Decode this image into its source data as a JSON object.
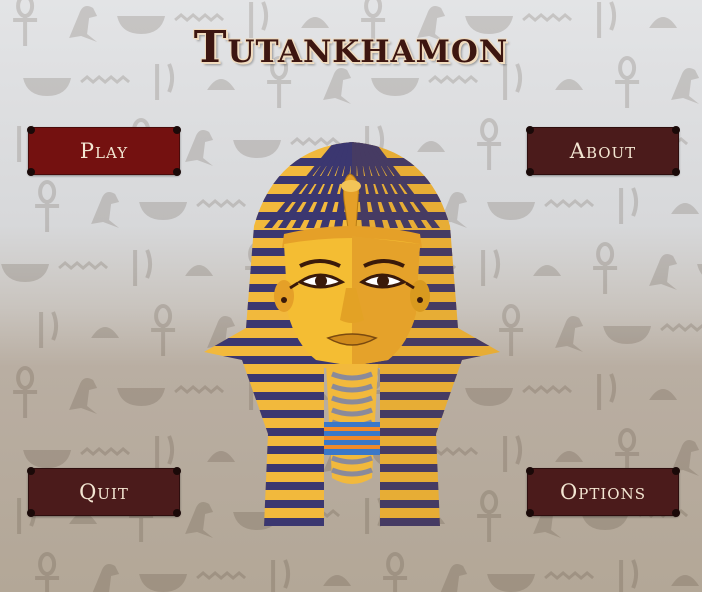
{
  "game": {
    "title": "Tutankhamon"
  },
  "menu": {
    "play_label": "Play",
    "about_label": "About",
    "quit_label": "Quit",
    "options_label": "Options"
  },
  "colors": {
    "title": "#3d1611",
    "play_button": "#741110",
    "button": "#4b1b1b",
    "button_text": "#f3e6d2",
    "gold": "#f2b93c",
    "gold_dark": "#d99a1f",
    "stripe": "#3b3770"
  },
  "icons": [
    "ankh-icon",
    "bird-icon",
    "eye-icon",
    "bowl-icon",
    "snake-icon",
    "pharaoh-mask-icon"
  ]
}
